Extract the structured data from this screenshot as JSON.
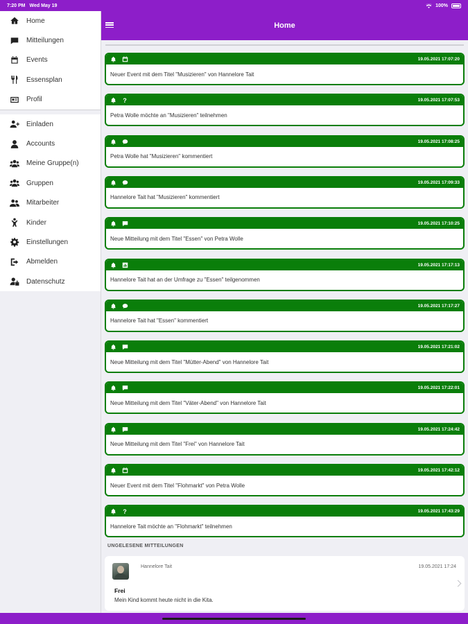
{
  "status": {
    "time": "7:20 PM",
    "date": "Wed May 19",
    "battery": "100%"
  },
  "header": {
    "title": "Home"
  },
  "sidebar": {
    "group1": [
      {
        "label": "Home",
        "icon": "home-icon"
      },
      {
        "label": "Mitteilungen",
        "icon": "message-icon"
      },
      {
        "label": "Events",
        "icon": "calendar-icon"
      },
      {
        "label": "Essensplan",
        "icon": "utensils-icon"
      },
      {
        "label": "Profil",
        "icon": "id-card-icon"
      }
    ],
    "group2": [
      {
        "label": "Einladen",
        "icon": "user-plus-icon"
      },
      {
        "label": "Accounts",
        "icon": "user-icon"
      },
      {
        "label": "Meine Gruppe(n)",
        "icon": "users-icon"
      },
      {
        "label": "Gruppen",
        "icon": "users-icon"
      },
      {
        "label": "Mitarbeiter",
        "icon": "user-friends-icon"
      },
      {
        "label": "Kinder",
        "icon": "child-icon"
      },
      {
        "label": "Einstellungen",
        "icon": "gear-icon"
      },
      {
        "label": "Abmelden",
        "icon": "sign-out-icon"
      },
      {
        "label": "Datenschutz",
        "icon": "user-lock-icon"
      }
    ]
  },
  "feed": [
    {
      "type": "calendar",
      "time": "19.05.2021 17:07:20",
      "text": "Neuer Event mit dem Titel \"Musizieren\" von Hannelore Tait"
    },
    {
      "type": "question",
      "time": "19.05.2021 17:07:53",
      "text": "Petra Wolle möchte an \"Musizieren\" teilnehmen"
    },
    {
      "type": "comment",
      "time": "19.05.2021 17:08:25",
      "text": "Petra Wolle hat \"Musizieren\" kommentiert"
    },
    {
      "type": "comment",
      "time": "19.05.2021 17:09:33",
      "text": "Hannelore Tait hat \"Musizieren\" kommentiert"
    },
    {
      "type": "message",
      "time": "19.05.2021 17:10:25",
      "text": "Neue Mitteilung mit dem Titel \"Essen\" von Petra Wolle"
    },
    {
      "type": "poll",
      "time": "19.05.2021 17:17:13",
      "text": "Hannelore Tait hat an der Umfrage zu \"Essen\" teilgenommen"
    },
    {
      "type": "comment",
      "time": "19.05.2021 17:17:27",
      "text": "Hannelore Tait hat \"Essen\" kommentiert"
    },
    {
      "type": "message",
      "time": "19.05.2021 17:21:02",
      "text": "Neue Mitteilung mit dem Titel \"Mütter-Abend\" von Hannelore Tait"
    },
    {
      "type": "message",
      "time": "19.05.2021 17:22:01",
      "text": "Neue Mitteilung mit dem Titel \"Väter-Abend\" von Hannelore Tait"
    },
    {
      "type": "message",
      "time": "19.05.2021 17:24:42",
      "text": "Neue Mitteilung mit dem Titel \"Frei\" von Hannelore Tait"
    },
    {
      "type": "calendar",
      "time": "19.05.2021 17:42:12",
      "text": "Neuer Event mit dem Titel \"Flohmarkt\" von Petra Wolle"
    },
    {
      "type": "question",
      "time": "19.05.2021 17:43:29",
      "text": "Hannelore Tait möchte an \"Flohmarkt\" teilnehmen"
    }
  ],
  "unread": {
    "section_title": "UNGELESENE MITTEILUNGEN",
    "author": "Hannelore Tait",
    "date": "19.05.2021 17:24",
    "subject": "Frei",
    "message": "Mein Kind kommt heute nicht in die Kita."
  },
  "colors": {
    "accent": "#8d1ec9",
    "card_green": "#0a7e0a",
    "background": "#efeff4"
  }
}
